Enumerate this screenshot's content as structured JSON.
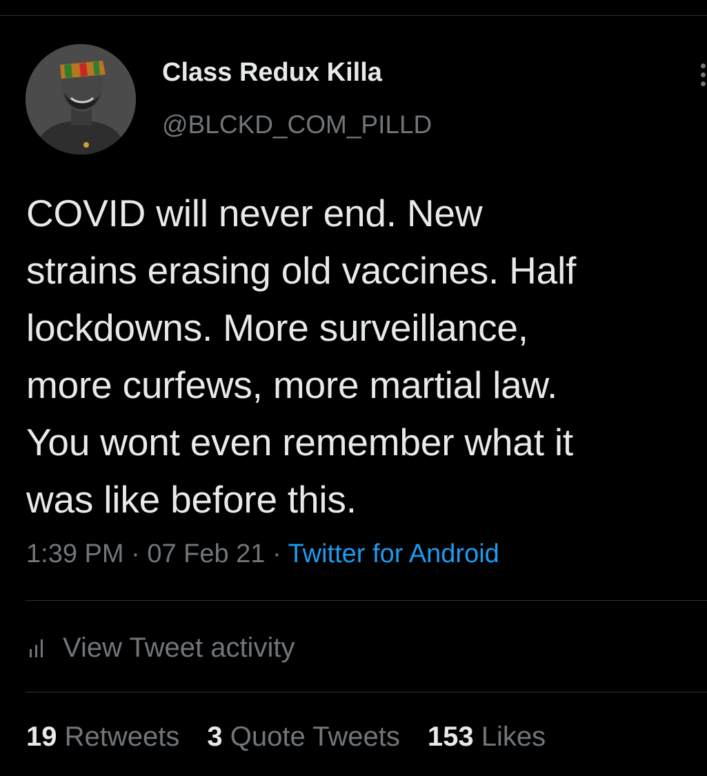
{
  "tweet": {
    "author": {
      "display_name": "Class Redux Killa",
      "handle": "@BLCKD_COM_PILLD"
    },
    "text": "COVID will never end. New\nstrains erasing old vaccines. Half\nlockdowns. More surveillance,\nmore curfews, more martial law.\nYou wont even remember what it\nwas like before this.",
    "time": "1:39 PM",
    "separator": "·",
    "date": "07 Feb 21",
    "source": "Twitter for Android"
  },
  "activity": {
    "label": "View Tweet activity",
    "icon": "bar-chart-icon"
  },
  "stats": {
    "retweets": {
      "count": "19",
      "label": "Retweets"
    },
    "quotes": {
      "count": "3",
      "label": "Quote Tweets"
    },
    "likes": {
      "count": "153",
      "label": "Likes"
    }
  },
  "colors": {
    "background": "#000000",
    "text_primary": "#e7e9ea",
    "text_secondary": "#71767b",
    "link": "#1d9bf0",
    "divider": "#2f3336"
  }
}
